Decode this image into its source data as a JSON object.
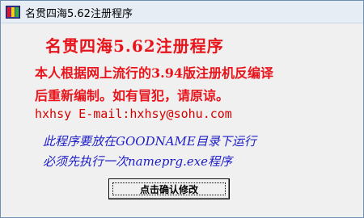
{
  "window": {
    "title": "名贯四海5.62注册程序",
    "icon": "window-app-icon",
    "colors": {
      "accent_red": "#e8141b",
      "blue_text": "#1e1ec8",
      "titlebar": "#e6edf5"
    }
  },
  "content": {
    "heading": "名贯四海5.62注册程序",
    "description_line1": "本人根据网上流行的3.94版注册机反编译",
    "description_line2": "后重新编制。如有冒犯，请原谅。",
    "contact": "hxhsy   E-mail:hxhsy@sohu.com",
    "instruction_line1": "此程序要放在GOODNAME目录下运行",
    "instruction_line2": "必须先执行一次nameprg.exe程序"
  },
  "button": {
    "confirm_label": "点击确认修改"
  }
}
